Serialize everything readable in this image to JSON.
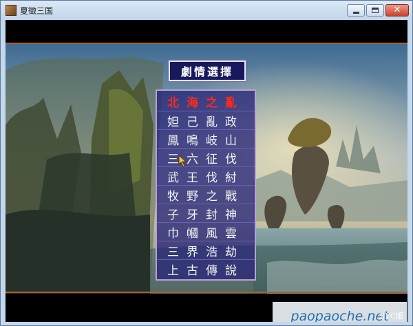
{
  "window": {
    "title": "夏徵三国",
    "close_glyph": "✕"
  },
  "header": {
    "title": "劇情選擇"
  },
  "scenarios": [
    {
      "label": "北海之亂",
      "selected": true
    },
    {
      "label": "妲己亂政",
      "selected": false
    },
    {
      "label": "鳳鳴岐山",
      "selected": false
    },
    {
      "label": "三六征伐",
      "selected": false
    },
    {
      "label": "武王伐紂",
      "selected": false
    },
    {
      "label": "牧野之戰",
      "selected": false
    },
    {
      "label": "子牙封神",
      "selected": false
    },
    {
      "label": "巾幗風雲",
      "selected": false
    },
    {
      "label": "三界浩劫",
      "selected": false
    },
    {
      "label": "上古傳說",
      "selected": false
    }
  ],
  "watermark": "paopaoche.net",
  "version_badge": "XYC版",
  "colors": {
    "selected_text": "#ff2a1a",
    "menu_text": "#f4f4f4",
    "panel_bg": "#282878",
    "frame_accent": "#b0602c"
  }
}
